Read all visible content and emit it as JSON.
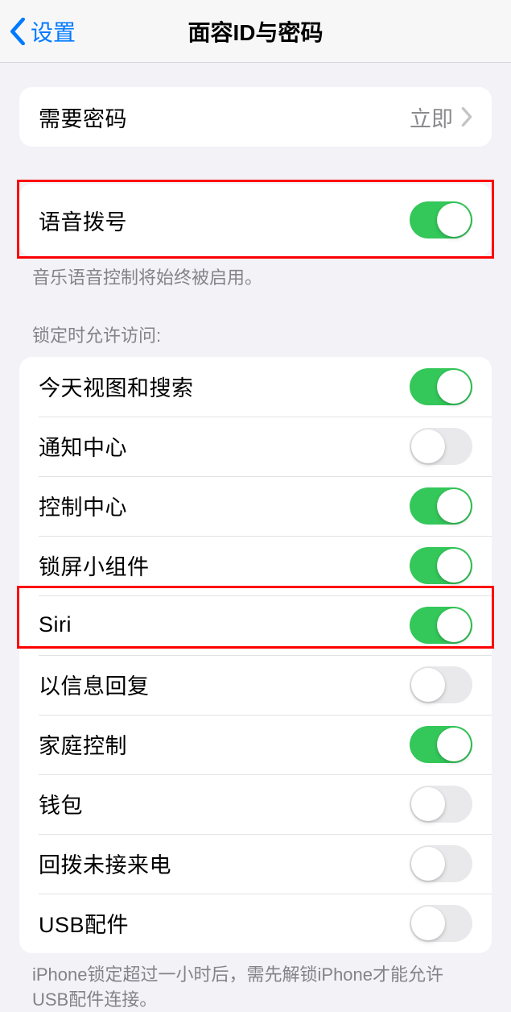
{
  "nav": {
    "back_label": "设置",
    "title": "面容ID与密码"
  },
  "require_passcode": {
    "label": "需要密码",
    "value": "立即"
  },
  "voice_dial": {
    "label": "语音拨号",
    "on": true,
    "footer": "音乐语音控制将始终被启用。"
  },
  "lock_access": {
    "header": "锁定时允许访问:",
    "items": [
      {
        "label": "今天视图和搜索",
        "on": true
      },
      {
        "label": "通知中心",
        "on": false
      },
      {
        "label": "控制中心",
        "on": true
      },
      {
        "label": "锁屏小组件",
        "on": true
      },
      {
        "label": "Siri",
        "on": true
      },
      {
        "label": "以信息回复",
        "on": false
      },
      {
        "label": "家庭控制",
        "on": true
      },
      {
        "label": "钱包",
        "on": false
      },
      {
        "label": "回拨未接来电",
        "on": false
      },
      {
        "label": "USB配件",
        "on": false
      }
    ],
    "footer": "iPhone锁定超过一小时后，需先解锁iPhone才能允许USB配件连接。"
  }
}
